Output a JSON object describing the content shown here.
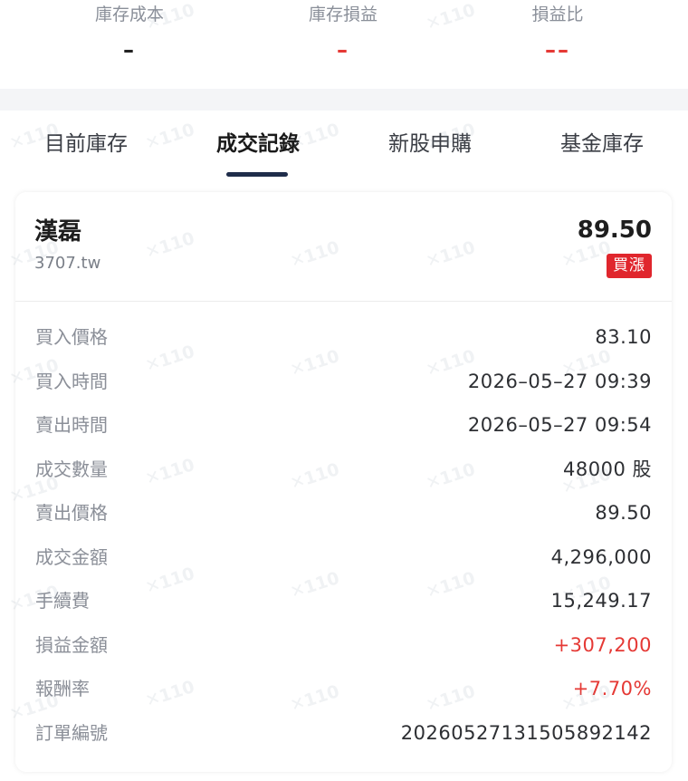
{
  "summary": {
    "cost": {
      "label": "庫存成本",
      "value": "–"
    },
    "pl": {
      "label": "庫存損益",
      "value": "–"
    },
    "ratio": {
      "label": "損益比",
      "value": "––"
    }
  },
  "tabs": [
    {
      "label": "目前庫存",
      "active": false
    },
    {
      "label": "成交記錄",
      "active": true
    },
    {
      "label": "新股申購",
      "active": false
    },
    {
      "label": "基金庫存",
      "active": false
    }
  ],
  "trade": {
    "name": "漢磊",
    "code": "3707.tw",
    "price": "89.50",
    "badge": "買漲",
    "details": [
      {
        "label": "買入價格",
        "value": "83.10"
      },
      {
        "label": "買入時間",
        "value": "2026–05–27 09:39"
      },
      {
        "label": "賣出時間",
        "value": "2026–05–27 09:54"
      },
      {
        "label": "成交數量",
        "value": "48000 股"
      },
      {
        "label": "賣出價格",
        "value": "89.50"
      },
      {
        "label": "成交金額",
        "value": "4,296,000"
      },
      {
        "label": "手續費",
        "value": "15,249.17"
      },
      {
        "label": "損益金額",
        "value": "+307,200"
      },
      {
        "label": "報酬率",
        "value": "+7.70%"
      },
      {
        "label": "訂單編號",
        "value": "20260527131505892142"
      }
    ]
  },
  "colors": {
    "positive": "#e53935",
    "badge_bg": "#e0262d",
    "tab_underline": "#1f2d4a"
  }
}
